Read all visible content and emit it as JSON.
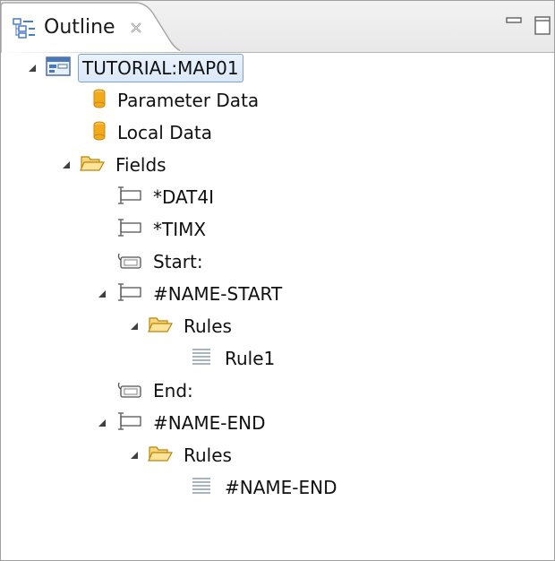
{
  "tab": {
    "label": "Outline"
  },
  "tree": {
    "map": "TUTORIAL:MAP01",
    "parameter_data": "Parameter Data",
    "local_data": "Local Data",
    "fields": "Fields",
    "field_dat4i": "*DAT4I",
    "field_timx": "*TIMX",
    "start": "Start:",
    "name_start": "#NAME-START",
    "rules_1": "Rules",
    "rule1": "Rule1",
    "end": "End:",
    "name_end": "#NAME-END",
    "rules_2": "Rules",
    "rule_name_end": "#NAME-END"
  },
  "colors": {
    "selection_border": "#7da2ce",
    "selection_fill": "#dbe8f8",
    "folder": "#f0b840",
    "cylinder": "#f2a91c"
  },
  "icons": {
    "tab": "outline-icon",
    "close": "close-icon",
    "map": "map-form-icon",
    "data": "database-icon",
    "folder": "folder-open-icon",
    "field": "input-field-icon",
    "start": "marker-icon",
    "rule": "text-lines-icon"
  }
}
